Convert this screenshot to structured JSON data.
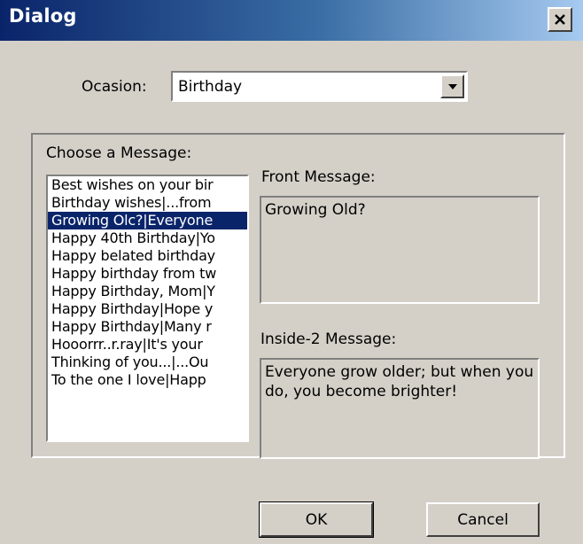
{
  "window": {
    "title": "Dialog",
    "close_icon": "close-icon"
  },
  "occasion": {
    "label": "Ocasion:",
    "selected": "Birthday",
    "dropdown_icon": "chevron-down-icon"
  },
  "messages": {
    "group_label": "Choose a Message:",
    "items": [
      "Best wishes on your bir",
      "Birthday wishes|...from",
      "Growing Olc?|Everyone",
      "Happy 40th Birthday|Yo",
      "Happy belated birthday",
      "Happy birthday from tw",
      "Happy Birthday, Mom|Y",
      "Happy Birthday|Hope y",
      "Happy Birthday|Many r",
      "Hooorrr..r.ray|It's your",
      "Thinking of you...|...Ou",
      "To the one I love|Happ"
    ],
    "selected_index": 2
  },
  "front": {
    "label": "Front Message:",
    "value": "Growing Old?"
  },
  "inside": {
    "label": "Inside-2 Message:",
    "value": "Everyone grow older; but when you do, you become brighter!"
  },
  "buttons": {
    "ok": "OK",
    "cancel": "Cancel"
  },
  "colors": {
    "dialog_bg": "#d4d0c8",
    "title_start": "#0a246a",
    "title_end": "#a6caf0",
    "selection": "#0a246a"
  }
}
